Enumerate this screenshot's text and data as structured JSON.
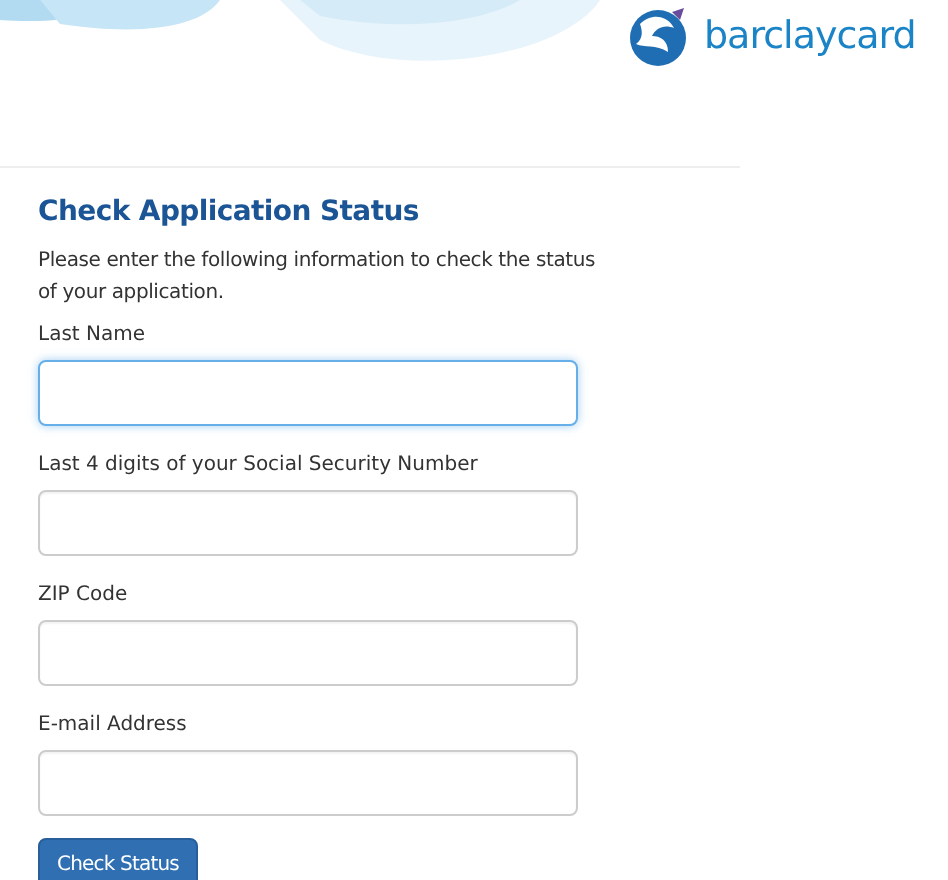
{
  "header": {
    "logo_text": "barclaycard"
  },
  "form": {
    "title": "Check Application Status",
    "intro": "Please enter the following information to check the status of your application.",
    "fields": [
      {
        "label": "Last Name",
        "focused": true
      },
      {
        "label": "Last 4 digits of your Social Security Number",
        "focused": false
      },
      {
        "label": "ZIP Code",
        "focused": false
      },
      {
        "label": "E-mail Address",
        "focused": false
      }
    ],
    "submit": "Check Status"
  }
}
